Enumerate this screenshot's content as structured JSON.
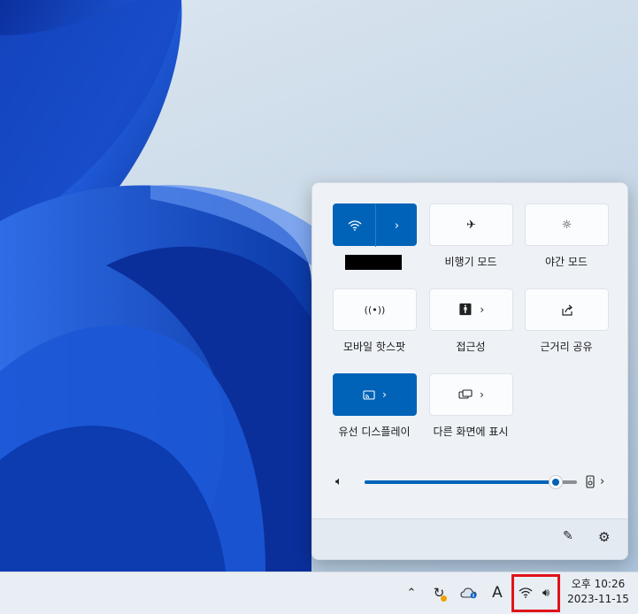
{
  "quick_settings": {
    "tiles": [
      {
        "id": "wifi",
        "label": "",
        "icon": "wifi-icon",
        "active": true,
        "has_chevron": true,
        "label_redacted": true
      },
      {
        "id": "airplane",
        "label": "비행기 모드",
        "icon": "airplane-icon",
        "active": false,
        "has_chevron": false
      },
      {
        "id": "night",
        "label": "야간 모드",
        "icon": "brightness-icon",
        "active": false,
        "has_chevron": false
      },
      {
        "id": "hotspot",
        "label": "모바일 핫스팟",
        "icon": "hotspot-icon",
        "active": false,
        "has_chevron": false
      },
      {
        "id": "accessibility",
        "label": "접근성",
        "icon": "accessibility-icon",
        "active": false,
        "has_chevron": true
      },
      {
        "id": "nearby",
        "label": "근거리 공유",
        "icon": "share-icon",
        "active": false,
        "has_chevron": false
      },
      {
        "id": "cast",
        "label": "유선 디스플레이",
        "icon": "cast-icon",
        "active": true,
        "has_chevron": true
      },
      {
        "id": "project",
        "label": "다른 화면에 표시",
        "icon": "project-icon",
        "active": false,
        "has_chevron": true
      }
    ],
    "volume": {
      "level": 0.9,
      "icon": "volume-icon",
      "device_icon": "speaker-device-icon"
    },
    "footer": {
      "edit_icon": "pencil-icon",
      "settings_icon": "gear-icon"
    }
  },
  "taskbar": {
    "tray_icons": [
      "chevron-up-icon",
      "sync-icon",
      "onedrive-icon",
      "ime-icon",
      "wifi-icon",
      "volume-icon"
    ],
    "ime_label": "A",
    "clock": {
      "time": "오후 10:26",
      "date": "2023-11-15"
    }
  },
  "colors": {
    "accent": "#0063b8",
    "highlight": "#e0131a"
  }
}
